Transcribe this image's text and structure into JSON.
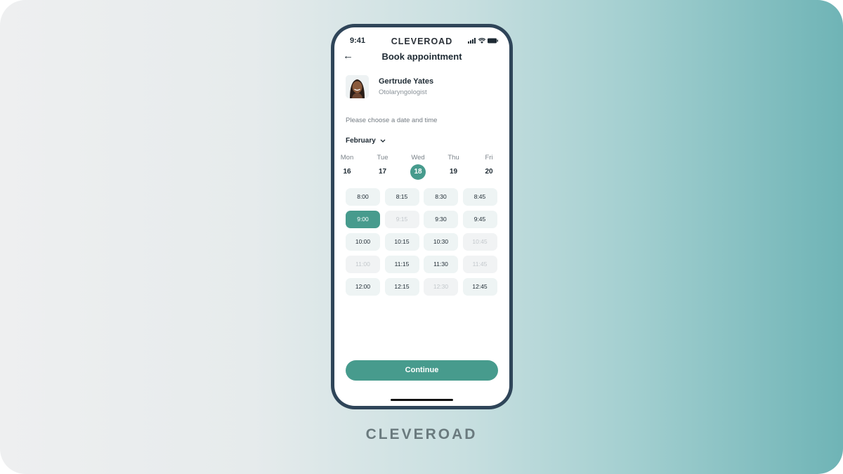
{
  "status_bar": {
    "time": "9:41",
    "brand": "CLEVEROAD",
    "icons": [
      "signal-icon",
      "wifi-icon",
      "battery-icon"
    ]
  },
  "header": {
    "back_icon": "arrow-left-icon",
    "title": "Book appointment"
  },
  "doctor": {
    "name": "Gertrude Yates",
    "specialty": "Otolaryngologist"
  },
  "prompt": "Please choose a date and time",
  "month": {
    "label": "February",
    "icon": "chevron-down-icon"
  },
  "days": [
    {
      "name": "Mon",
      "date": "16",
      "selected": false
    },
    {
      "name": "Tue",
      "date": "17",
      "selected": false
    },
    {
      "name": "Wed",
      "date": "18",
      "selected": true
    },
    {
      "name": "Thu",
      "date": "19",
      "selected": false
    },
    {
      "name": "Fri",
      "date": "20",
      "selected": false
    }
  ],
  "slots": [
    {
      "time": "8:00",
      "state": "available"
    },
    {
      "time": "8:15",
      "state": "available"
    },
    {
      "time": "8:30",
      "state": "available"
    },
    {
      "time": "8:45",
      "state": "available"
    },
    {
      "time": "9:00",
      "state": "selected"
    },
    {
      "time": "9:15",
      "state": "disabled"
    },
    {
      "time": "9:30",
      "state": "available"
    },
    {
      "time": "9:45",
      "state": "available"
    },
    {
      "time": "10:00",
      "state": "available"
    },
    {
      "time": "10:15",
      "state": "available"
    },
    {
      "time": "10:30",
      "state": "available"
    },
    {
      "time": "10:45",
      "state": "disabled"
    },
    {
      "time": "11:00",
      "state": "disabled"
    },
    {
      "time": "11:15",
      "state": "available"
    },
    {
      "time": "11:30",
      "state": "available"
    },
    {
      "time": "11:45",
      "state": "disabled"
    },
    {
      "time": "12:00",
      "state": "available"
    },
    {
      "time": "12:15",
      "state": "available"
    },
    {
      "time": "12:30",
      "state": "disabled"
    },
    {
      "time": "12:45",
      "state": "available"
    }
  ],
  "continue_label": "Continue",
  "footer_brand": "CLEVEROAD",
  "colors": {
    "accent": "#479b8d",
    "frame": "#2f4559",
    "slot_bg": "#eef4f4"
  }
}
